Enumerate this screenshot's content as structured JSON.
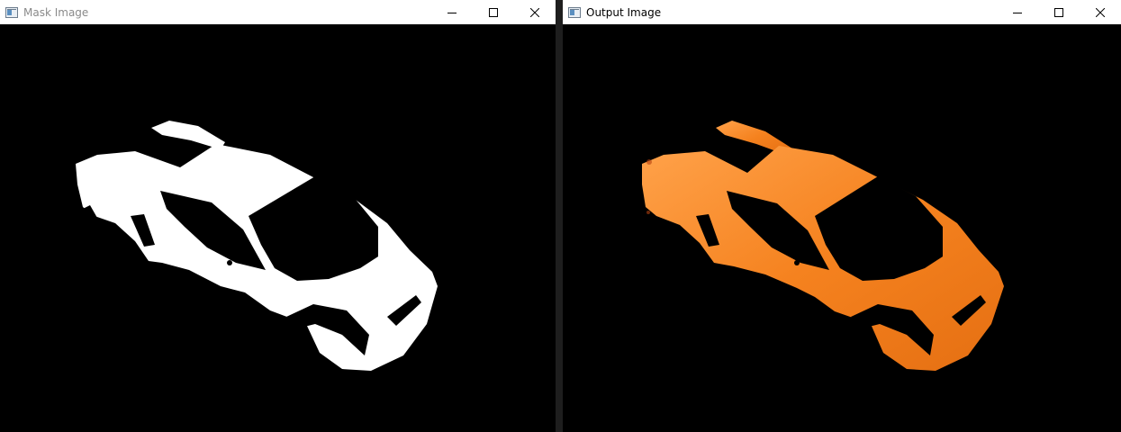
{
  "windows": [
    {
      "title": "Mask Image",
      "controls": {
        "minimize": "minimize-icon",
        "maximize": "maximize-icon",
        "close": "close-icon"
      },
      "content": {
        "kind": "binary-mask",
        "color": "#ffffff"
      }
    },
    {
      "title": "Output Image",
      "controls": {
        "minimize": "minimize-icon",
        "maximize": "maximize-icon",
        "close": "close-icon"
      },
      "content": {
        "kind": "segmented-car",
        "color": "#f5821f"
      }
    }
  ],
  "colors": {
    "titlebar": "#ffffff",
    "canvas": "#000000",
    "car_orange": "#f5821f",
    "car_highlight": "#ffa24a"
  }
}
